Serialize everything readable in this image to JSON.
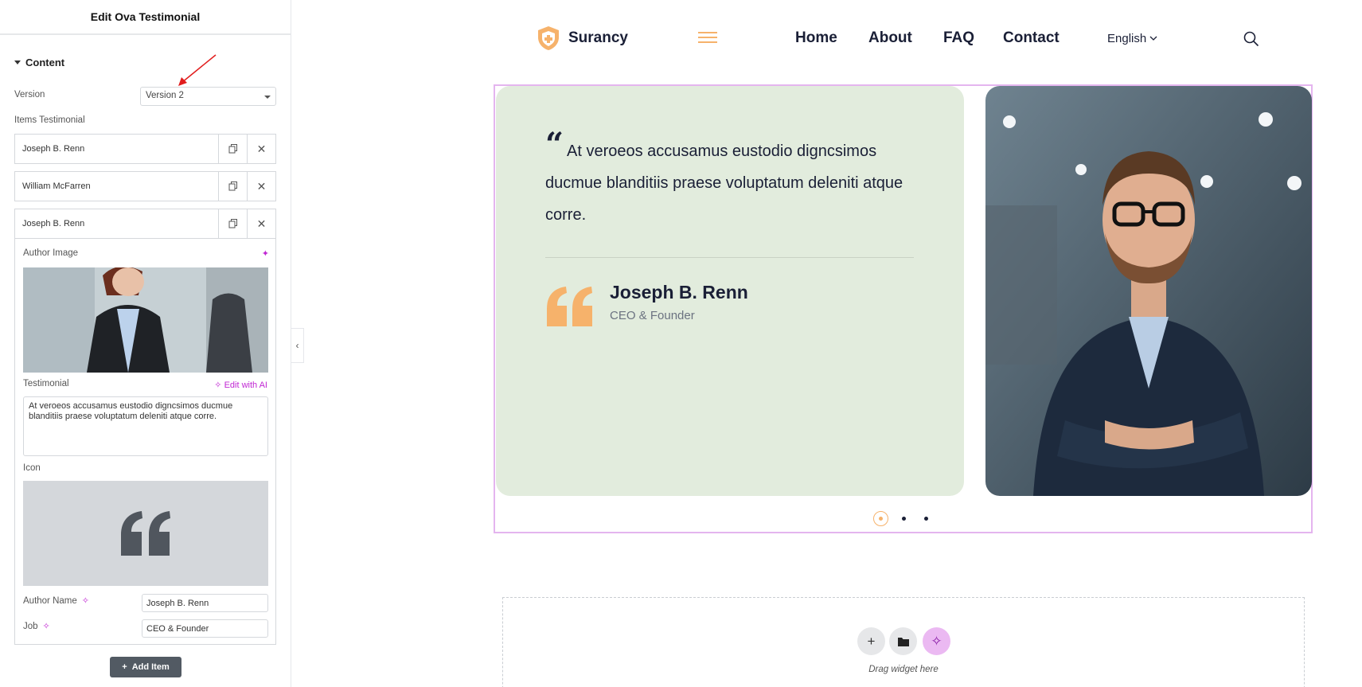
{
  "panel": {
    "title": "Edit Ova Testimonial",
    "section": "Content",
    "version_label": "Version",
    "version_value": "Version 2",
    "items_label": "Items Testimonial",
    "items": [
      {
        "title": "Joseph B. Renn"
      },
      {
        "title": "William McFarren"
      },
      {
        "title": "Joseph B. Renn"
      }
    ],
    "author_image_label": "Author Image",
    "testimonial_label": "Testimonial",
    "edit_ai_label": "Edit with AI",
    "testimonial_value": "At veroeos accusamus eustodio digncsimos ducmue blanditiis praese voluptatum deleniti atque corre.",
    "icon_label": "Icon",
    "author_name_label": "Author Name",
    "author_name_value": "Joseph B. Renn",
    "job_label": "Job",
    "job_value": "CEO & Founder",
    "add_item_label": "Add Item"
  },
  "site": {
    "logo_text": "Surancy",
    "nav": [
      "Home",
      "About",
      "FAQ",
      "Contact"
    ],
    "language": "English"
  },
  "testimonial": {
    "quote_mark": "“",
    "text": "At veroeos accusamus eustodio digncsimos ducmue blanditiis praese voluptatum deleniti atque corre.",
    "author": "Joseph B. Renn",
    "job": "CEO & Founder",
    "slides": 3,
    "active_slide": 1
  },
  "drop_zone": {
    "text": "Drag widget here"
  },
  "colors": {
    "accent": "#f6b26b",
    "card_bg": "#e2ecdd",
    "ai": "#c026d3",
    "dark": "#1a1f36"
  }
}
